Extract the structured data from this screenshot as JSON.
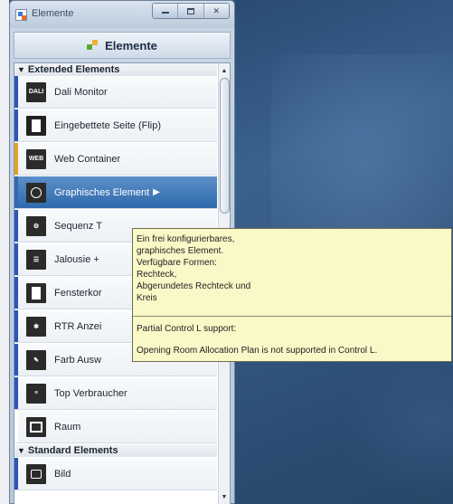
{
  "window": {
    "title": "Elemente"
  },
  "header": {
    "title": "Elemente"
  },
  "sections": [
    {
      "label": "Extended Elements"
    },
    {
      "label": "Standard Elements"
    }
  ],
  "items": [
    {
      "label": "Dali Monitor",
      "icon": "dali-icon",
      "accent": "#2a54b8"
    },
    {
      "label": "Eingebettete Seite (Flip)",
      "icon": "page-icon",
      "accent": "#2a54b8"
    },
    {
      "label": "Web Container",
      "icon": "web-container-icon",
      "accent": "#e8a020"
    },
    {
      "label": "Graphisches Element",
      "icon": "graphic-element-icon",
      "accent": "#2f6aae",
      "selected": true
    },
    {
      "label": "Sequenz T",
      "icon": "sequence-icon",
      "accent": "#2a54b8"
    },
    {
      "label": "Jalousie +",
      "icon": "blind-icon",
      "accent": "#2a54b8"
    },
    {
      "label": "Fensterkor",
      "icon": "window-contact-icon",
      "accent": "#2a54b8"
    },
    {
      "label": "RTR Anzei",
      "icon": "rtr-icon",
      "accent": "#2a54b8"
    },
    {
      "label": "Farb Ausw",
      "icon": "color-picker-icon",
      "accent": "#2a54b8"
    },
    {
      "label": "Top Verbraucher",
      "icon": "top-consumer-icon",
      "accent": "#2a54b8"
    },
    {
      "label": "Raum",
      "icon": "room-icon",
      "accent": "#ffffff"
    },
    {
      "label": "Bild",
      "icon": "image-icon",
      "accent": "#2a54b8"
    }
  ],
  "tooltip": {
    "line1": "Ein frei konfigurierbares,",
    "line2": "graphisches Element.",
    "line3": "Verfügbare Formen:",
    "line4": "Rechteck,",
    "line5": "Abgerundetes Rechteck und",
    "line6": "Kreis",
    "partial": "Partial Control L support:",
    "opening": "Opening Room Allocation Plan is not supported in Control L."
  },
  "colors": {
    "selection": "#2f6aae",
    "tooltip_bg": "#fbf8c8",
    "desktop": "#32557a"
  }
}
